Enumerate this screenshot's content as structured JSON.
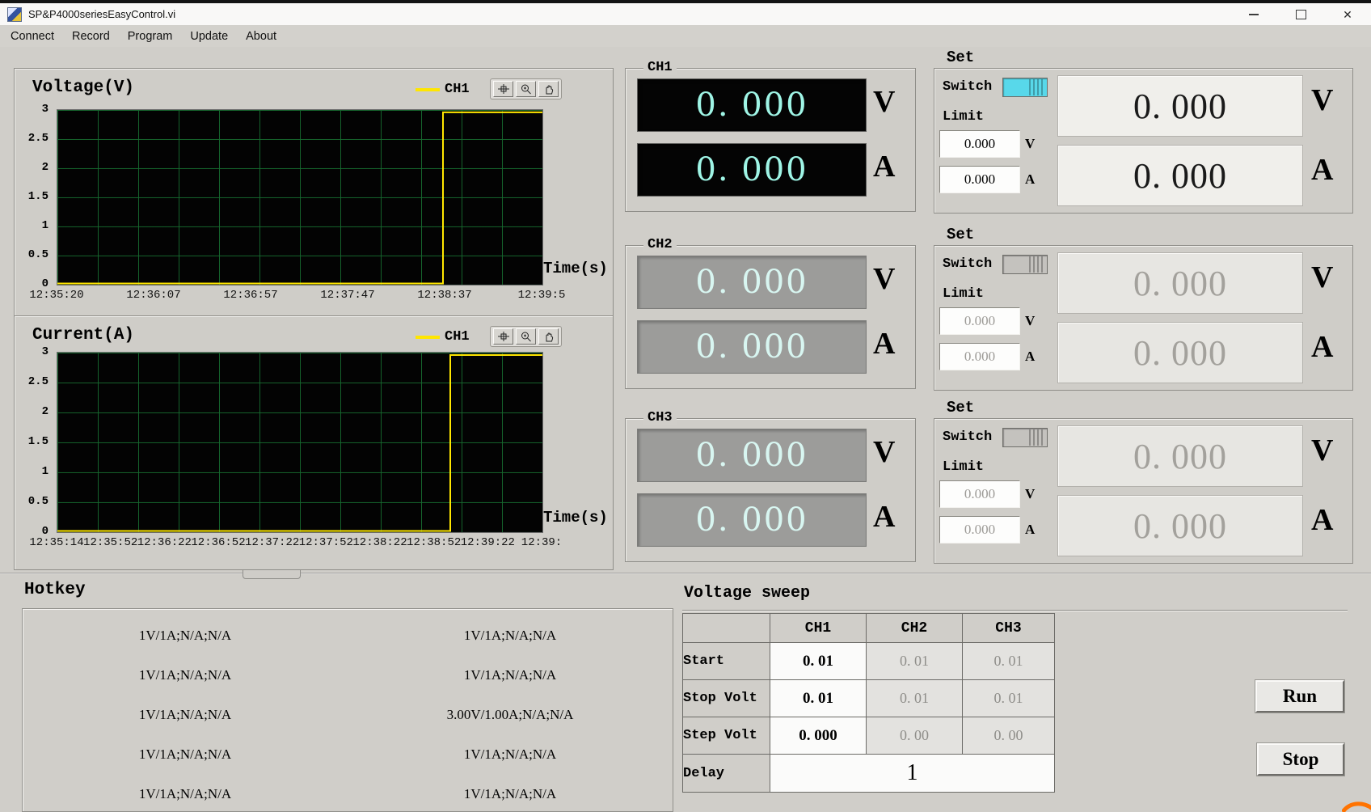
{
  "window": {
    "title": "SP&P4000seriesEasyControl.vi"
  },
  "menu": {
    "items": [
      "Connect",
      "Record",
      "Program",
      "Update",
      "About"
    ]
  },
  "chart_data": [
    {
      "type": "line",
      "title": "Voltage(V)",
      "legend": "CH1",
      "x_label": "Time(s)",
      "y_max": 3,
      "y_ticks": [
        "3",
        "2.5",
        "2",
        "1.5",
        "1",
        "0.5",
        "0"
      ],
      "x_ticks": [
        "12:35:20",
        "12:36:07",
        "12:36:57",
        "12:37:47",
        "12:38:37",
        "12:39:5"
      ],
      "trace_color": "#ffe600",
      "grid": true,
      "series": [
        {
          "name": "CH1",
          "points": [
            [
              0,
              0.02
            ],
            [
              0.795,
              0.02
            ],
            [
              0.795,
              2.96
            ],
            [
              1,
              2.96
            ]
          ]
        }
      ]
    },
    {
      "type": "line",
      "title": "Current(A)",
      "legend": "CH1",
      "x_label": "Time(s)",
      "y_max": 3,
      "y_ticks": [
        "3",
        "2.5",
        "2",
        "1.5",
        "1",
        "0.5",
        "0"
      ],
      "x_ticks": [
        "12:35:14",
        "12:35:52",
        "12:36:22",
        "12:36:52",
        "12:37:22",
        "12:37:52",
        "12:38:22",
        "12:38:52",
        "12:39:22",
        "12:39:"
      ],
      "trace_color": "#ffe600",
      "grid": true,
      "series": [
        {
          "name": "CH1",
          "points": [
            [
              0,
              0.02
            ],
            [
              0.81,
              0.02
            ],
            [
              0.81,
              2.96
            ],
            [
              1,
              2.96
            ]
          ]
        }
      ]
    }
  ],
  "channels": [
    {
      "name": "CH1",
      "voltage": "0. 000",
      "current": "0. 000",
      "volt_unit": "V",
      "amp_unit": "A",
      "enabled": true,
      "set": {
        "label": "Set",
        "switch_label": "Switch",
        "limit_label": "Limit",
        "limit_voltage": "0.000",
        "limit_current": "0.000",
        "set_voltage": "0. 000",
        "set_current": "0. 000"
      }
    },
    {
      "name": "CH2",
      "voltage": "0. 000",
      "current": "0. 000",
      "volt_unit": "V",
      "amp_unit": "A",
      "enabled": false,
      "set": {
        "label": "Set",
        "switch_label": "Switch",
        "limit_label": "Limit",
        "limit_voltage": "0.000",
        "limit_current": "0.000",
        "set_voltage": "0. 000",
        "set_current": "0. 000"
      }
    },
    {
      "name": "CH3",
      "voltage": "0. 000",
      "current": "0. 000",
      "volt_unit": "V",
      "amp_unit": "A",
      "enabled": false,
      "set": {
        "label": "Set",
        "switch_label": "Switch",
        "limit_label": "Limit",
        "limit_voltage": "0.000",
        "limit_current": "0.000",
        "set_voltage": "0. 000",
        "set_current": "0. 000"
      }
    }
  ],
  "hotkey": {
    "title": "Hotkey",
    "left_column": [
      "1V/1A;N/A;N/A",
      "1V/1A;N/A;N/A",
      "1V/1A;N/A;N/A",
      "1V/1A;N/A;N/A",
      "1V/1A;N/A;N/A"
    ],
    "right_column": [
      "1V/1A;N/A;N/A",
      "1V/1A;N/A;N/A",
      "3.00V/1.00A;N/A;N/A",
      "1V/1A;N/A;N/A",
      "1V/1A;N/A;N/A"
    ]
  },
  "sweep": {
    "title": "Voltage sweep",
    "col_headers": [
      "CH1",
      "CH2",
      "CH3"
    ],
    "rows": [
      {
        "label": "Start",
        "values": [
          "0. 01",
          "0. 01",
          "0. 01"
        ]
      },
      {
        "label": "Stop Volt",
        "values": [
          "0. 01",
          "0. 01",
          "0. 01"
        ]
      },
      {
        "label": "Step Volt",
        "values": [
          "0. 000",
          "0. 00",
          "0. 00"
        ]
      }
    ],
    "delay_label": "Delay",
    "delay_value": "1",
    "run_label": "Run",
    "stop_label": "Stop"
  },
  "colors": {
    "display_text_cyan": "#9ff5e6",
    "switch_on": "#58d8ea",
    "trace_yellow": "#ffe600",
    "grid_green": "#16682e",
    "accent_orange": "#ff7300"
  }
}
